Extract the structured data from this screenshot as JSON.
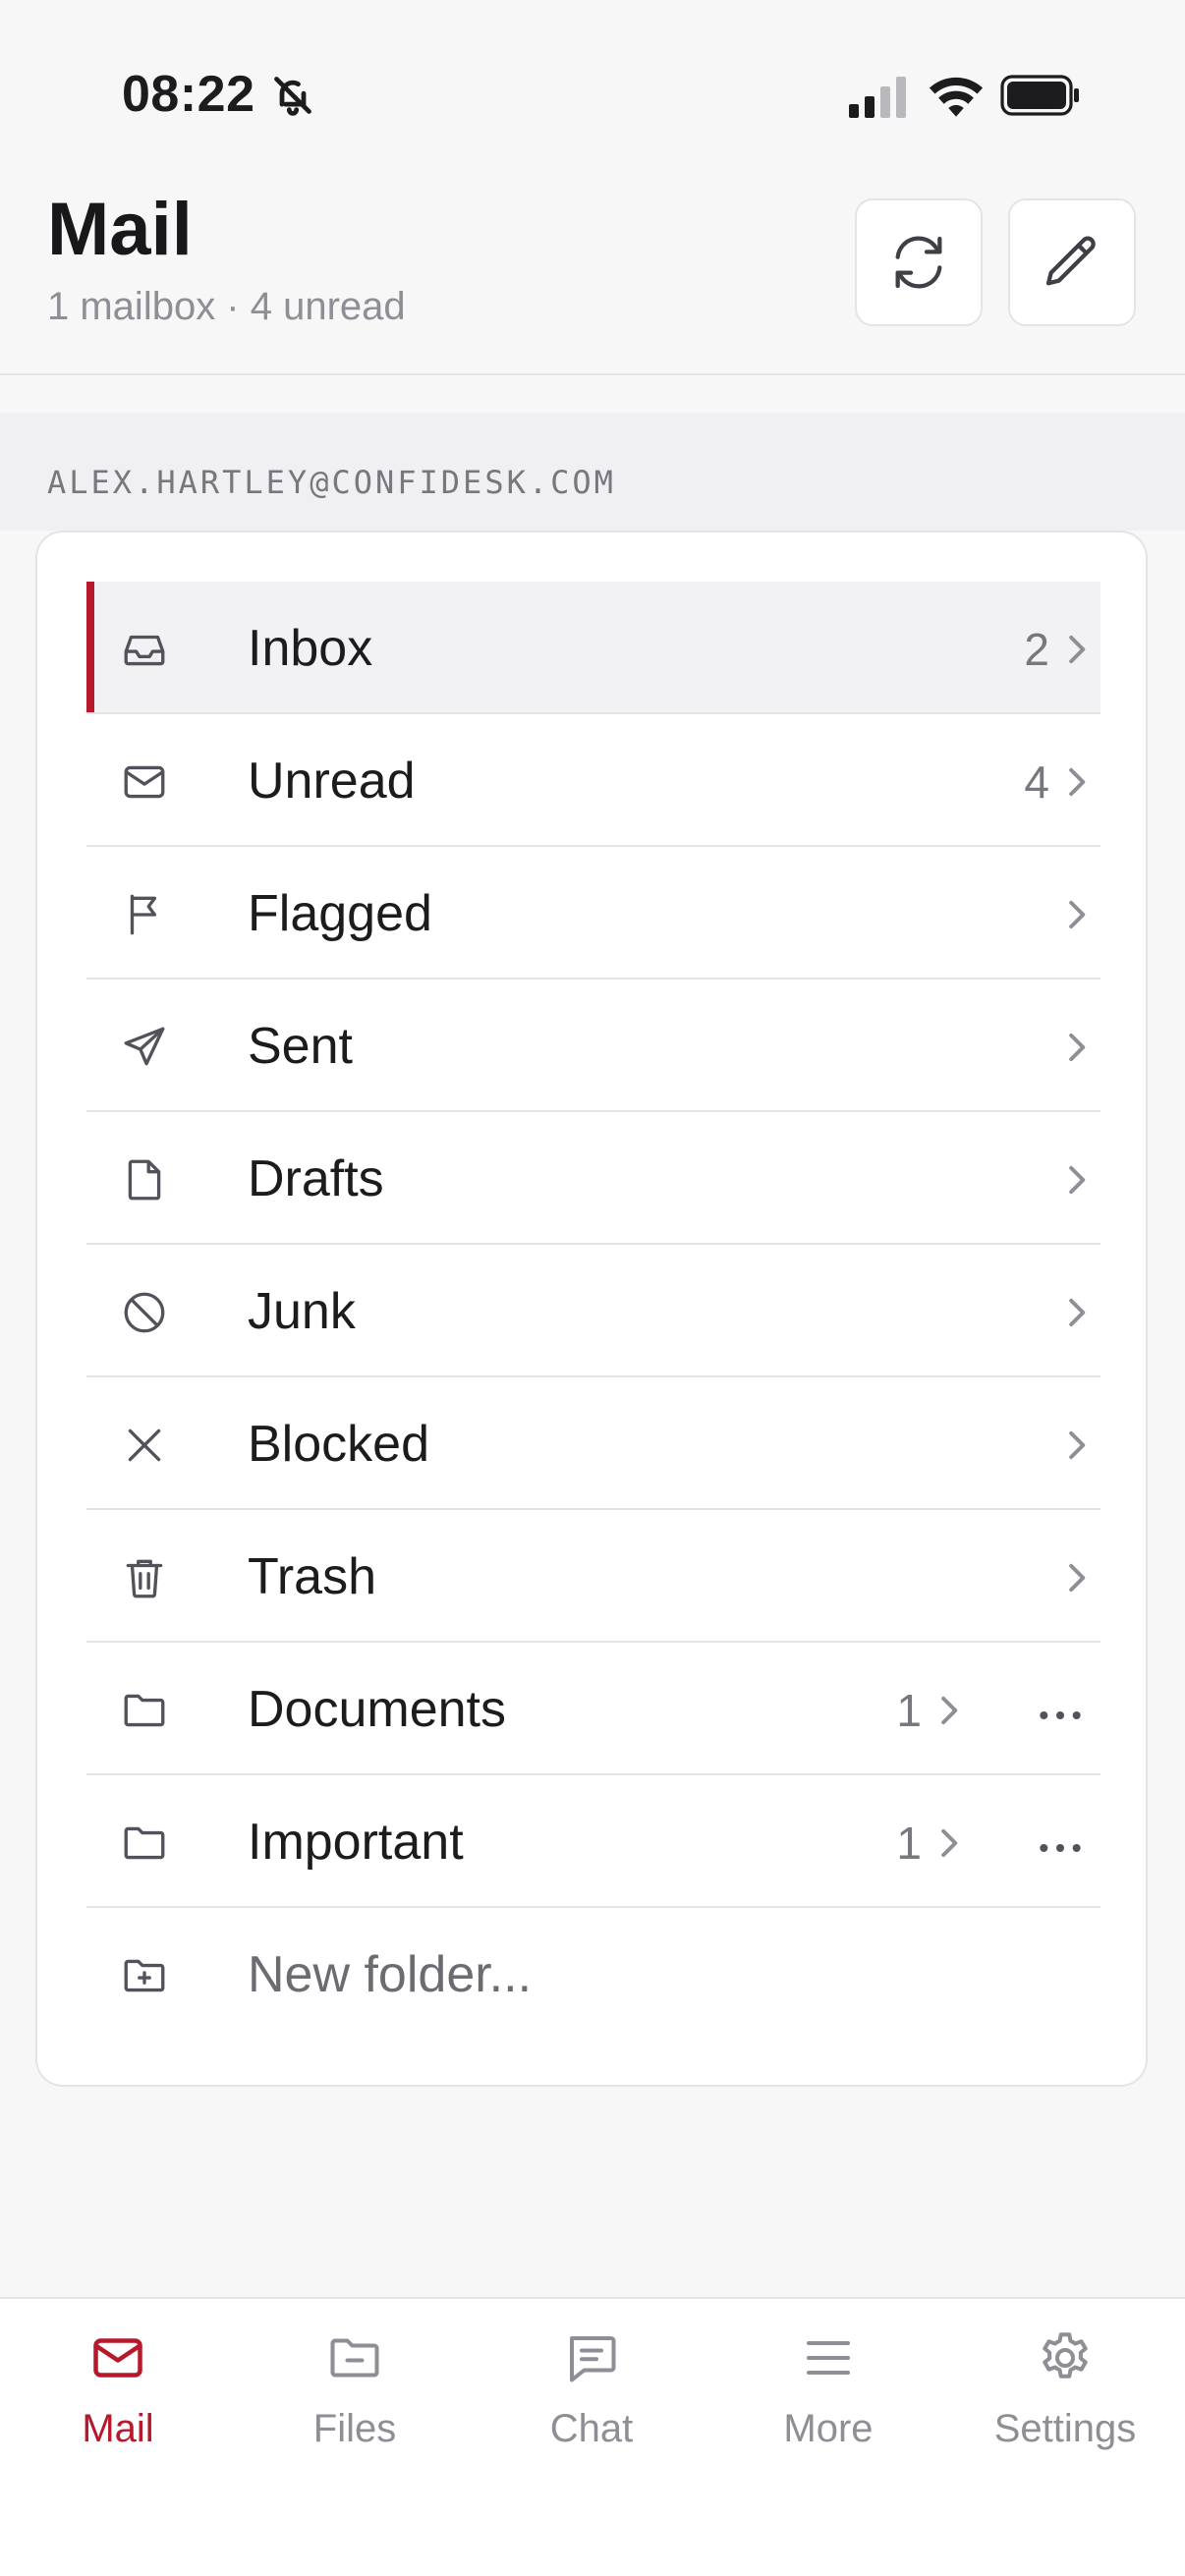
{
  "status_bar": {
    "time": "08:22",
    "icons": [
      "bell-slash-icon",
      "signal-icon",
      "wifi-icon",
      "battery-icon"
    ]
  },
  "header": {
    "title": "Mail",
    "subtitle": "1 mailbox · 4 unread",
    "buttons": [
      "refresh-icon",
      "compose-icon"
    ]
  },
  "account": {
    "email": "ALEX.HARTLEY@CONFIDESK.COM"
  },
  "folders": [
    {
      "label": "Inbox",
      "count": "2",
      "icon": "inbox-icon",
      "active": true
    },
    {
      "label": "Unread",
      "count": "4",
      "icon": "envelope-icon"
    },
    {
      "label": "Flagged",
      "count": "",
      "icon": "flag-icon"
    },
    {
      "label": "Sent",
      "count": "",
      "icon": "send-icon"
    },
    {
      "label": "Drafts",
      "count": "",
      "icon": "document-icon"
    },
    {
      "label": "Junk",
      "count": "",
      "icon": "ban-icon"
    },
    {
      "label": "Blocked",
      "count": "",
      "icon": "x-icon"
    },
    {
      "label": "Trash",
      "count": "",
      "icon": "trash-icon"
    },
    {
      "label": "Documents",
      "count": "1",
      "icon": "folder-icon",
      "custom": true
    },
    {
      "label": "Important",
      "count": "1",
      "icon": "folder-icon",
      "custom": true
    }
  ],
  "new_folder": {
    "label": "New folder...",
    "icon": "folder-plus-icon"
  },
  "tab_bar": {
    "tabs": [
      {
        "label": "Mail",
        "icon": "mail-icon",
        "active": true
      },
      {
        "label": "Files",
        "icon": "folder-icon"
      },
      {
        "label": "Chat",
        "icon": "chat-icon"
      },
      {
        "label": "More",
        "icon": "menu-icon"
      },
      {
        "label": "Settings",
        "icon": "gear-icon"
      }
    ]
  },
  "colors": {
    "accent": "#b5192b",
    "background": "#f7f7f8",
    "muted_text": "#8e8e95",
    "divider": "#e4e4e7"
  }
}
